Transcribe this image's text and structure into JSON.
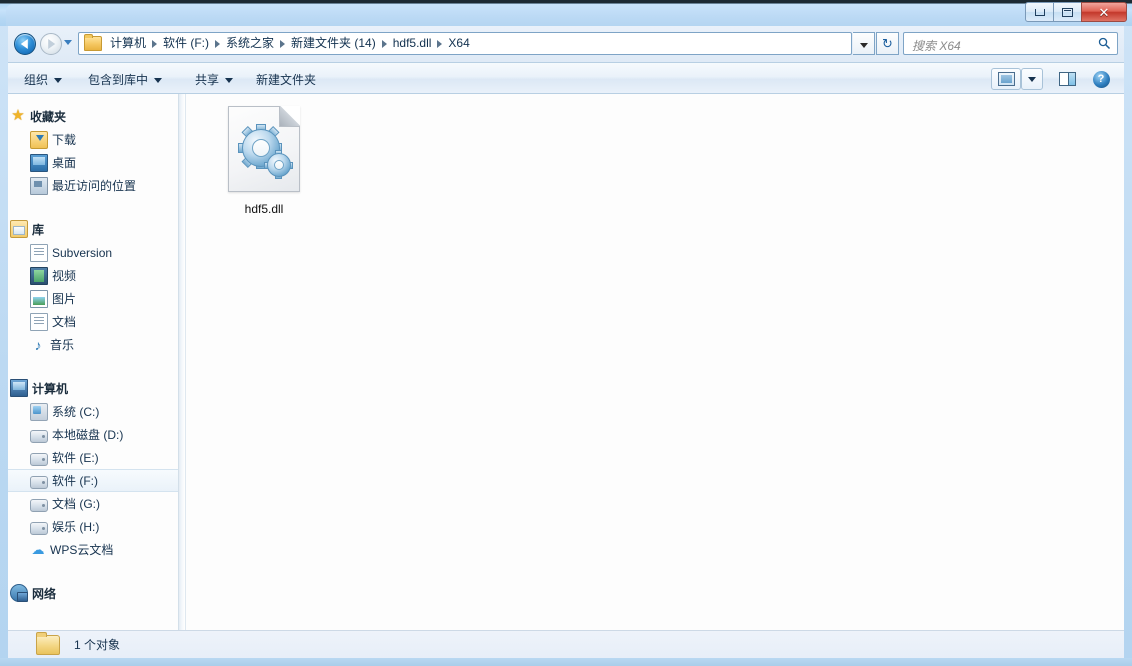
{
  "window": {
    "buttons": {
      "minimize": "–",
      "maximize": "□",
      "close": "✕"
    }
  },
  "address": {
    "back_tooltip": "后退",
    "forward_tooltip": "前进",
    "breadcrumbs": [
      "计算机",
      "软件 (F:)",
      "系统之家",
      "新建文件夹 (14)",
      "hdf5.dll",
      "X64"
    ],
    "refresh": "↻"
  },
  "search": {
    "placeholder": "搜索 X64",
    "icon": "search-icon"
  },
  "toolbar": {
    "organize": "组织",
    "include_in_library": "包含到库中",
    "share": "共享",
    "new_folder": "新建文件夹",
    "help_glyph": "?"
  },
  "sidebar": {
    "groups": [
      {
        "label": "收藏夹",
        "icon": "star-icon",
        "items": [
          {
            "label": "下载",
            "icon": "downloads-icon"
          },
          {
            "label": "桌面",
            "icon": "desktop-icon"
          },
          {
            "label": "最近访问的位置",
            "icon": "recent-places-icon"
          }
        ]
      },
      {
        "label": "库",
        "icon": "library-icon",
        "items": [
          {
            "label": "Subversion",
            "icon": "document-icon"
          },
          {
            "label": "视频",
            "icon": "video-icon"
          },
          {
            "label": "图片",
            "icon": "picture-icon"
          },
          {
            "label": "文档",
            "icon": "document-icon"
          },
          {
            "label": "音乐",
            "icon": "music-icon"
          }
        ]
      },
      {
        "label": "计算机",
        "icon": "computer-icon",
        "items": [
          {
            "label": "系统 (C:)",
            "icon": "system-drive-icon",
            "selected": false
          },
          {
            "label": "本地磁盘 (D:)",
            "icon": "drive-icon",
            "selected": false
          },
          {
            "label": "软件 (E:)",
            "icon": "drive-icon",
            "selected": false
          },
          {
            "label": "软件 (F:)",
            "icon": "drive-icon",
            "selected": true
          },
          {
            "label": "文档 (G:)",
            "icon": "drive-icon",
            "selected": false
          },
          {
            "label": "娱乐 (H:)",
            "icon": "drive-icon",
            "selected": false
          },
          {
            "label": "WPS云文档",
            "icon": "cloud-icon",
            "selected": false
          }
        ]
      },
      {
        "label": "网络",
        "icon": "network-icon",
        "items": []
      }
    ]
  },
  "content": {
    "files": [
      {
        "name": "hdf5.dll",
        "icon": "dll-gears-icon",
        "selected": false
      }
    ]
  },
  "status": {
    "item_count_text": "1 个对象",
    "folder_icon": "folder-icon"
  }
}
